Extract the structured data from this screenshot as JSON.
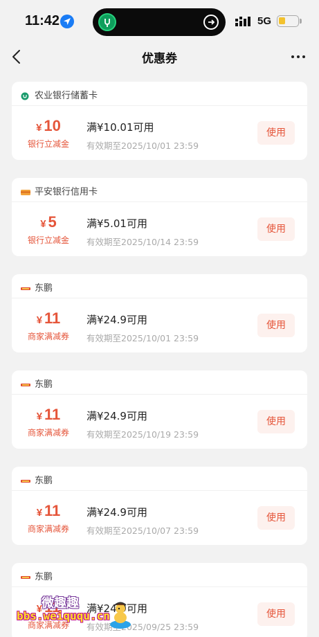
{
  "status_bar": {
    "time": "11:42",
    "network": "5G",
    "battery_level": 0.35,
    "colors": {
      "location": "#1a7cf5",
      "battery": "#f3c22e"
    }
  },
  "nav": {
    "title": "优惠券",
    "back_icon": "chevron-left-icon",
    "more_icon": "more-horizontal-icon"
  },
  "accent_color": "#e5553a",
  "coupons": [
    {
      "issuer": "农业银行储蓄卡",
      "issuer_icon": "abc-bank-icon",
      "currency": "¥",
      "amount": "10",
      "type": "银行立减金",
      "condition": "满¥10.01可用",
      "validity": "有效期至2025/10/01 23:59",
      "action": "使用"
    },
    {
      "issuer": "平安银行信用卡",
      "issuer_icon": "pingan-bank-icon",
      "currency": "¥",
      "amount": "5",
      "type": "银行立减金",
      "condition": "满¥5.01可用",
      "validity": "有效期至2025/10/14 23:59",
      "action": "使用"
    },
    {
      "issuer": "东鹏",
      "issuer_icon": "dongpeng-icon",
      "currency": "¥",
      "amount": "11",
      "type": "商家满减券",
      "condition": "满¥24.9可用",
      "validity": "有效期至2025/10/01 23:59",
      "action": "使用"
    },
    {
      "issuer": "东鹏",
      "issuer_icon": "dongpeng-icon",
      "currency": "¥",
      "amount": "11",
      "type": "商家满减券",
      "condition": "满¥24.9可用",
      "validity": "有效期至2025/10/19 23:59",
      "action": "使用"
    },
    {
      "issuer": "东鹏",
      "issuer_icon": "dongpeng-icon",
      "currency": "¥",
      "amount": "11",
      "type": "商家满减券",
      "condition": "满¥24.9可用",
      "validity": "有效期至2025/10/07 23:59",
      "action": "使用"
    },
    {
      "issuer": "东鹏",
      "issuer_icon": "dongpeng-icon",
      "currency": "¥",
      "amount": "11",
      "type": "商家满减券",
      "condition": "满¥24.9可用",
      "validity": "有效期至2025/09/25 23:59",
      "action": "使用"
    }
  ],
  "watermark": {
    "title": "微趣趣",
    "url": "bbs.weiququ.cn"
  }
}
